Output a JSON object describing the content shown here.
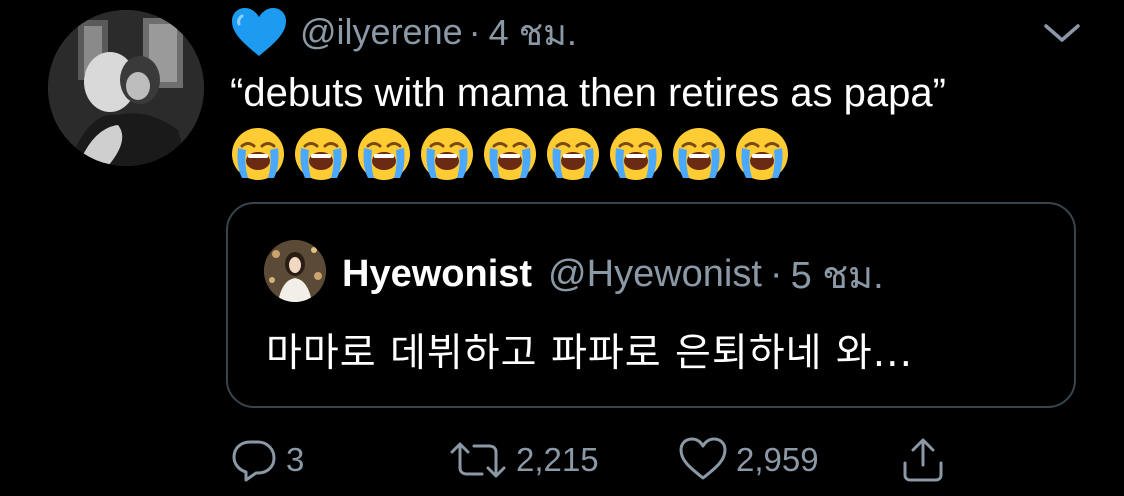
{
  "tweet": {
    "badge_icon": "blue-heart-emoji",
    "handle": "@ilyerene",
    "separator": "·",
    "time": "4 ชม.",
    "text": "“debuts with mama then retires as papa”",
    "emoji_name": "loudly-crying-face-emoji",
    "emoji_count": 9,
    "menu_icon": "chevron-down-icon"
  },
  "quote": {
    "display_name": "Hyewonist",
    "handle": "@Hyewonist",
    "separator": "·",
    "time": "5 ชม.",
    "text": "마마로 데뷔하고 파파로 은퇴하네 와..."
  },
  "actions": {
    "reply_count": "3",
    "retweet_count": "2,215",
    "like_count": "2,959"
  },
  "colors": {
    "background": "#000000",
    "text_primary": "#ffffff",
    "text_secondary": "#8b98a5",
    "card_border": "#38444d",
    "heart_blue": "#1d9bf0"
  }
}
